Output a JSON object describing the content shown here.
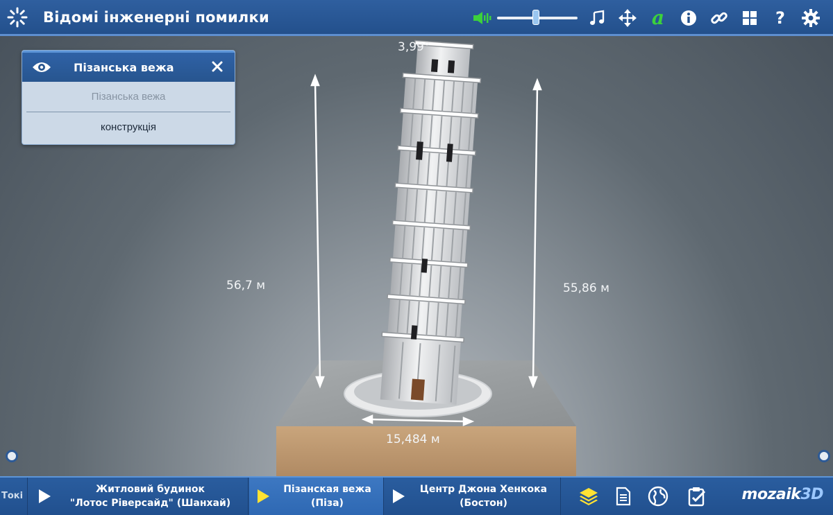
{
  "app": {
    "title": "Відомі інженерні помилки",
    "volume_level": 0.48
  },
  "toolbar": {
    "icons": [
      "speaker-icon",
      "music-note-icon",
      "move-arrows-icon",
      "font-a-icon",
      "info-icon",
      "link-icon",
      "grid-icon",
      "help-icon",
      "gear-icon"
    ],
    "help_label": "?",
    "font_label": "a",
    "accent_green": "#3cd13c"
  },
  "panel": {
    "title": "Пізанська вежа",
    "row1": "Пізанська вежа",
    "row2": "конструкція"
  },
  "scene": {
    "angle_label": "3,99°",
    "left_height": "56,7 м",
    "right_height": "55,86 м",
    "base_width": "15,484 м"
  },
  "bottom": {
    "partial_tab": "Токі",
    "tabs": [
      {
        "label_line1": "Житловий будинок",
        "label_line2": "\"Лотос Ріверсайд\" (Шанхай)",
        "active": false
      },
      {
        "label_line1": "Пізанская вежа",
        "label_line2": "(Піза)",
        "active": true
      },
      {
        "label_line1": "Центр Джона Хенкока",
        "label_line2": "(Бостон)",
        "active": false
      }
    ],
    "icons": [
      "layers-icon",
      "document-icon",
      "globe-icon",
      "clipboard-check-icon"
    ],
    "logo": "mozaik3D"
  }
}
